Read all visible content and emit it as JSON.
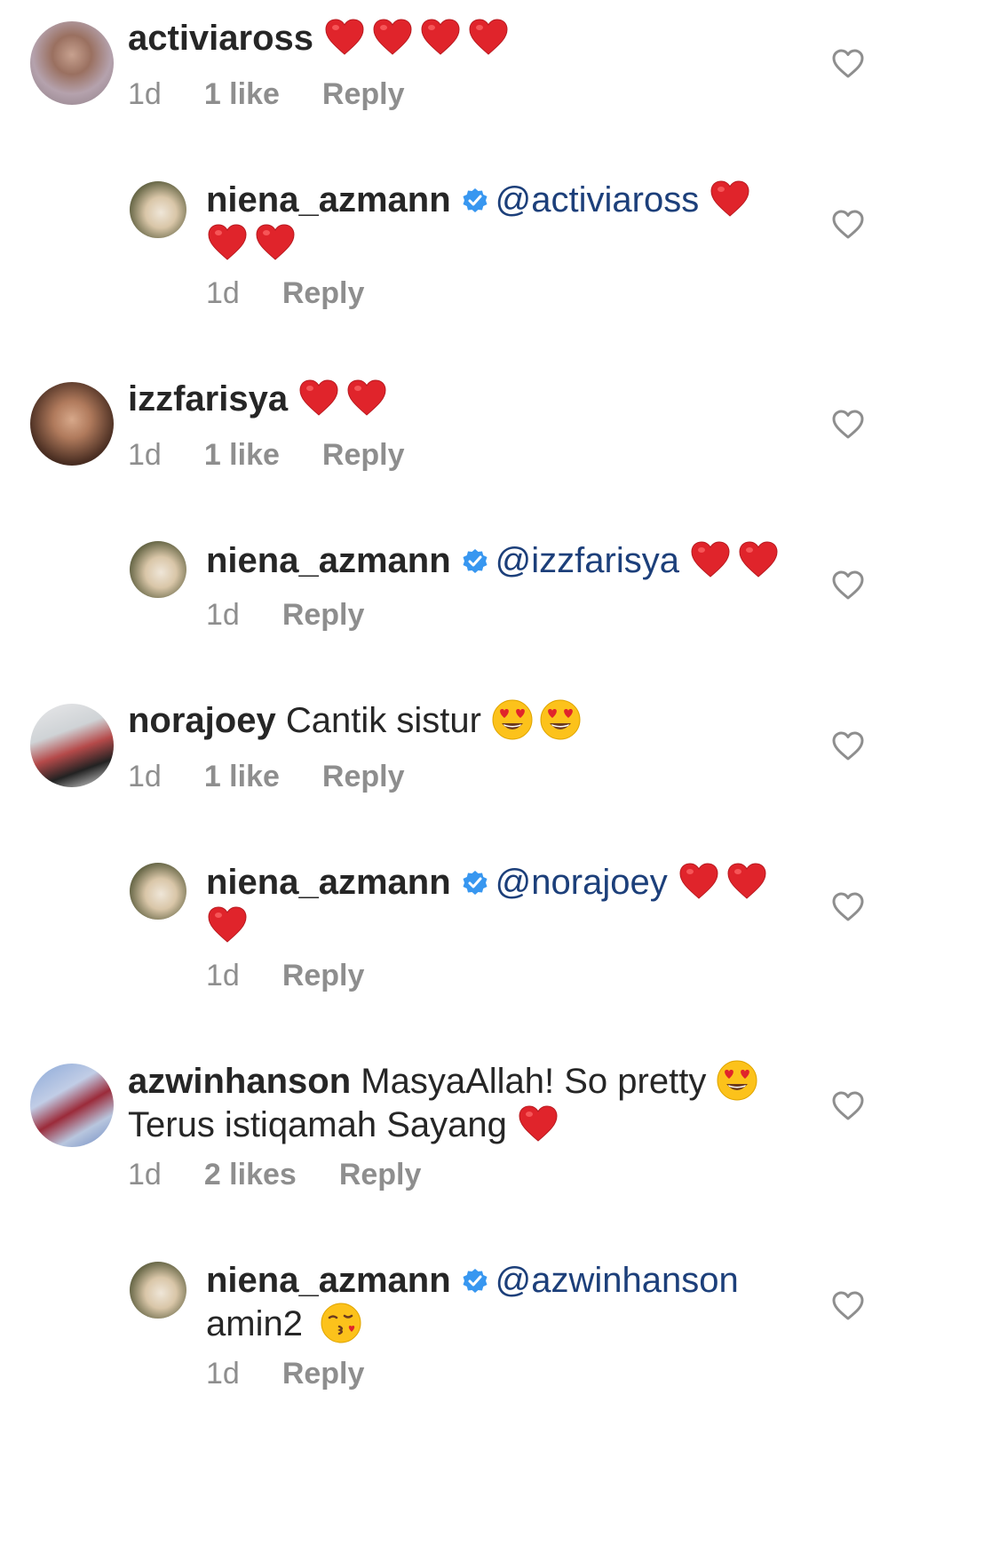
{
  "comments": [
    {
      "username": "activiaross",
      "text": "",
      "hearts": 4,
      "time": "1d",
      "likes": "1 like",
      "reply": "Reply"
    },
    {
      "username": "niena_azmann",
      "mention": "@activiaross",
      "text": "",
      "hearts": 3,
      "time": "1d",
      "reply": "Reply"
    },
    {
      "username": "izzfarisya",
      "text": "",
      "hearts": 2,
      "time": "1d",
      "likes": "1 like",
      "reply": "Reply"
    },
    {
      "username": "niena_azmann",
      "mention": "@izzfarisya",
      "text": "",
      "hearts": 2,
      "time": "1d",
      "reply": "Reply"
    },
    {
      "username": "norajoey",
      "text": "Cantik sistur",
      "emojis": "heart-eyes x2",
      "time": "1d",
      "likes": "1 like",
      "reply": "Reply"
    },
    {
      "username": "niena_azmann",
      "mention": "@norajoey",
      "text": "",
      "hearts": 3,
      "time": "1d",
      "reply": "Reply"
    },
    {
      "username": "azwinhanson",
      "text": "MasyaAllah! So pretty",
      "text2": "Terus istiqamah Sayang",
      "time": "1d",
      "likes": "2 likes",
      "reply": "Reply"
    },
    {
      "username": "niena_azmann",
      "mention": "@azwinhanson",
      "text": "amin2",
      "time": "1d",
      "reply": "Reply"
    }
  ],
  "colors": {
    "text": "#262626",
    "meta": "#8e8e8e",
    "mention": "#1c3f7a",
    "verified": "#3897f0",
    "heart": "#e0242b"
  },
  "icons": [
    "heart-outline-icon",
    "verified-badge-icon",
    "red-heart-emoji",
    "heart-eyes-emoji",
    "kiss-emoji"
  ]
}
